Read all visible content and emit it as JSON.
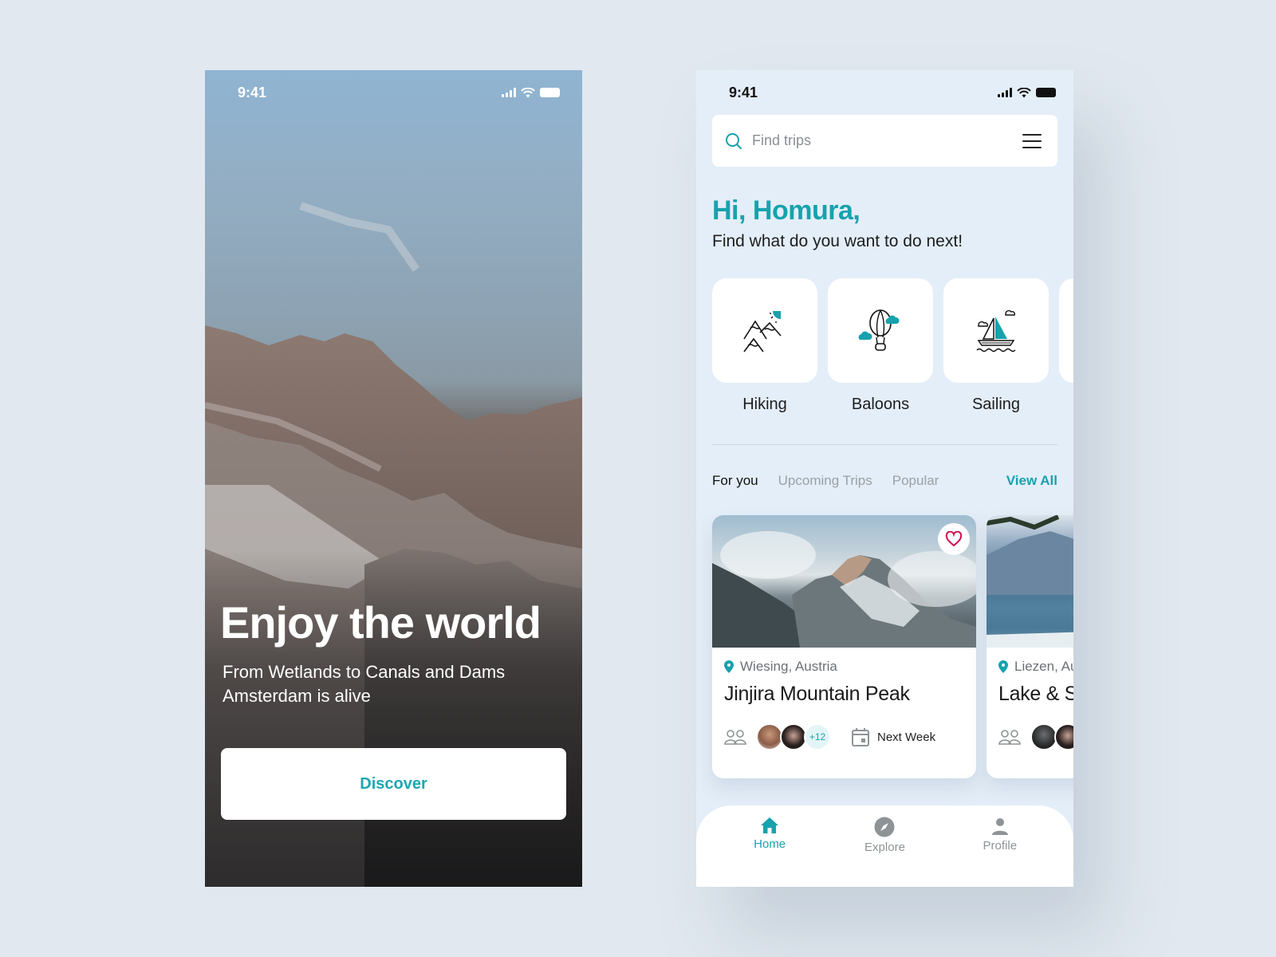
{
  "colors": {
    "accent": "#17a2ad",
    "favorite": "#d0104c",
    "background": "#e1e8ef"
  },
  "onboarding": {
    "status_time": "9:41",
    "title": "Enjoy the world",
    "subtitle_line1": "From Wetlands to Canals and Dams",
    "subtitle_line2": "Amsterdam is alive",
    "discover_label": "Discover"
  },
  "home": {
    "status_time": "9:41",
    "search": {
      "placeholder": "Find trips",
      "value": ""
    },
    "greeting": "Hi, Homura,",
    "prompt": "Find what do you want to do next!",
    "categories": [
      {
        "label": "Hiking",
        "icon": "mountains-icon"
      },
      {
        "label": "Baloons",
        "icon": "hot-air-balloon-icon"
      },
      {
        "label": "Sailing",
        "icon": "sailboat-icon"
      }
    ],
    "tabs": [
      {
        "label": "For you",
        "active": true
      },
      {
        "label": "Upcoming Trips",
        "active": false
      },
      {
        "label": "Popular",
        "active": false
      }
    ],
    "view_all": "View All",
    "trips": [
      {
        "location": "Wiesing, Austria",
        "title": "Jinjira Mountain Peak",
        "extra_people": "+12",
        "date": "Next Week",
        "favorite": true
      },
      {
        "location": "Liezen, Austria",
        "title": "Lake & S",
        "extra_people": "",
        "date": "",
        "favorite": false
      }
    ],
    "nav": [
      {
        "label": "Home",
        "icon": "home-icon",
        "active": true
      },
      {
        "label": "Explore",
        "icon": "compass-icon",
        "active": false
      },
      {
        "label": "Profile",
        "icon": "user-icon",
        "active": false
      }
    ]
  }
}
